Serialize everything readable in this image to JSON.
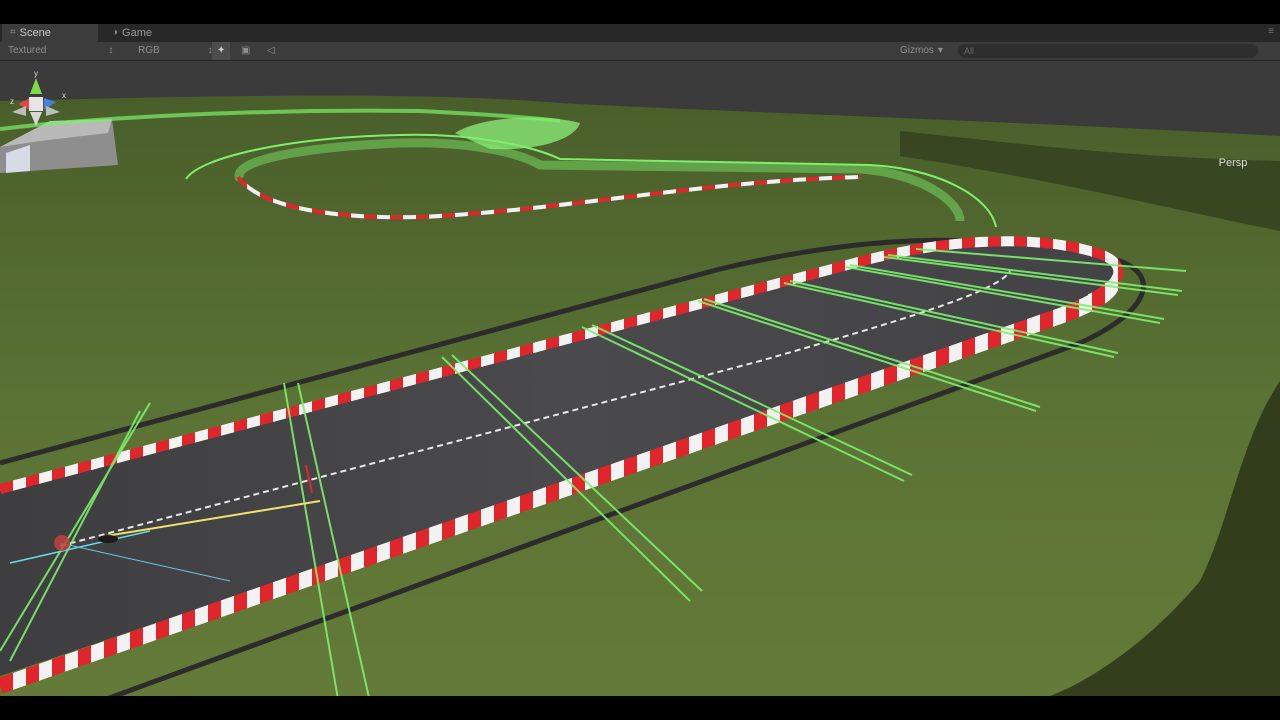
{
  "tabs": [
    {
      "label": "Scene",
      "icon": "scene-icon",
      "active": true
    },
    {
      "label": "Game",
      "icon": "game-icon",
      "active": false
    }
  ],
  "toolbar": {
    "render_mode": "Textured",
    "color_mode": "RGB",
    "gizmos_label": "Gizmos",
    "search_placeholder": "All"
  },
  "gizmo": {
    "projection": "Persp",
    "axes": [
      "x",
      "y",
      "z"
    ]
  },
  "colors": {
    "accent_green": "#66ff66",
    "grass": "#5c7334",
    "asphalt": "#48484a",
    "curb_red": "#e0262a",
    "curb_white": "#f2f2f2",
    "sky": "#3b3b3b"
  }
}
